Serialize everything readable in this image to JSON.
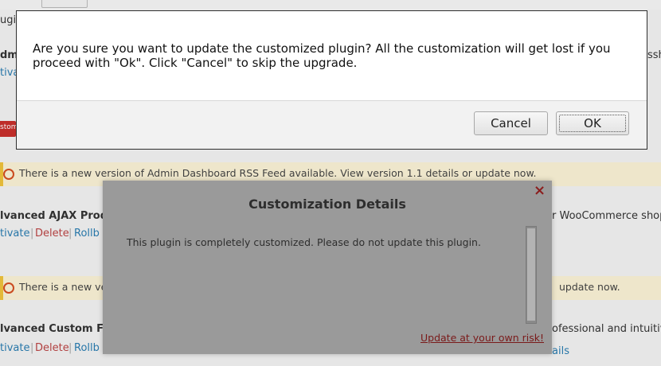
{
  "background": {
    "fragments": {
      "plugins_label": "ugi",
      "admin_frag": "dmi",
      "activate_1": "tivate",
      "admin_right": "ssh",
      "custom_badge": "stom",
      "plugin_adv_ajax": "lvanced AJAX Produc",
      "woocommerce_frag": "r WooCommerce shop.",
      "row2_activate": "tivate",
      "row2_delete": "Delete",
      "row2_rollback": "Rollb",
      "notice2_left": "There is a new vers",
      "notice2_right": "update now.",
      "plugin_adv_custom": "lvanced Custom Fiel",
      "professional_frag": "ofessional and intuitive F",
      "row3_activate": "tivate",
      "row3_delete": "Delete",
      "row3_rollback": "Rollb",
      "details_frag": "ails"
    },
    "notice1": "There is a new version of Admin Dashboard RSS Feed available. View version 1.1 details or update now."
  },
  "modal": {
    "title": "Customization Details",
    "close_glyph": "×",
    "body": "This plugin is completely customized. Please do not update this plugin.",
    "risk_link": "Update at your own risk!"
  },
  "dialog": {
    "message": "Are you sure you want to update the customized plugin? All the customization will get lost if you proceed with \"Ok\". Click \"Cancel\" to skip the upgrade.",
    "cancel_label": "Cancel",
    "ok_label": "OK"
  },
  "colors": {
    "notice_accent": "#f0c33c",
    "link": "#2a7db2",
    "risk_link": "#7a1a1a",
    "close": "#8b1e1e"
  }
}
